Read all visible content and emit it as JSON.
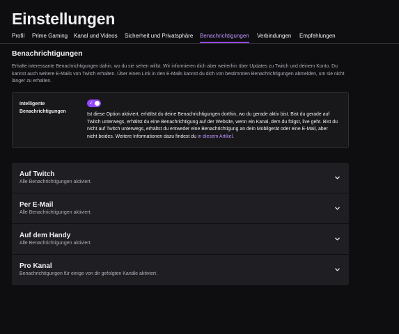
{
  "page": {
    "title": "Einstellungen"
  },
  "tabs": [
    {
      "label": "Profil"
    },
    {
      "label": "Prime Gaming"
    },
    {
      "label": "Kanal und Videos"
    },
    {
      "label": "Sicherheit und Privatsphäre"
    },
    {
      "label": "Benachrichtigungen",
      "active": true
    },
    {
      "label": "Verbindungen"
    },
    {
      "label": "Empfehlungen"
    }
  ],
  "notifications": {
    "heading": "Benachrichtigungen",
    "description": "Erhalte interessante Benachrichtigungen dahin, wo du sie sehen willst. Wir informieren dich aber weiterhin über Updates zu Twitch und deinem Konto. Du kannst auch weitere E-Mails von Twitch erhalten. Über einen Link in den E-Mails kannst du dich von bestimmten Benachrichtigungen abmelden, um sie nicht länger zu erhalten."
  },
  "smart_notifications": {
    "label": "Intelligente Benachrichtigungen",
    "enabled": true,
    "description": "Ist diese Option aktiviert, erhältst du deine Benachrichtigungen dorthin, wo du gerade aktiv bist. Bist du gerade auf Twitch unterwegs, erhältst du eine Benachrichtigung auf der Website, wenn ein Kanal, dem du folgst, live geht. Bist du nicht auf Twitch unterwegs, erhältst du entweder eine Benachrichtigung an dein Mobilgerät oder eine E-Mail, aber nicht beides. Weitere Informationen dazu findest du ",
    "link_text": "in diesem Artikel",
    "suffix": "."
  },
  "channels": [
    {
      "title": "Auf Twitch",
      "subtitle": "Alle Benachrichtigungen aktiviert."
    },
    {
      "title": "Per E-Mail",
      "subtitle": "Alle Benachrichtigungen aktiviert."
    },
    {
      "title": "Auf dem Handy",
      "subtitle": "Alle Benachrichtigungen aktiviert."
    },
    {
      "title": "Pro Kanal",
      "subtitle": "Benachrichtigungen für einige von dir gefolgten Kanäle aktiviert."
    }
  ],
  "icons": {
    "toggle": "check-icon",
    "expand": "chevron-down-icon"
  },
  "colors": {
    "accent": "#9147ff",
    "link": "#bf94ff",
    "background": "#0e0e10",
    "card": "#1f1f23"
  }
}
